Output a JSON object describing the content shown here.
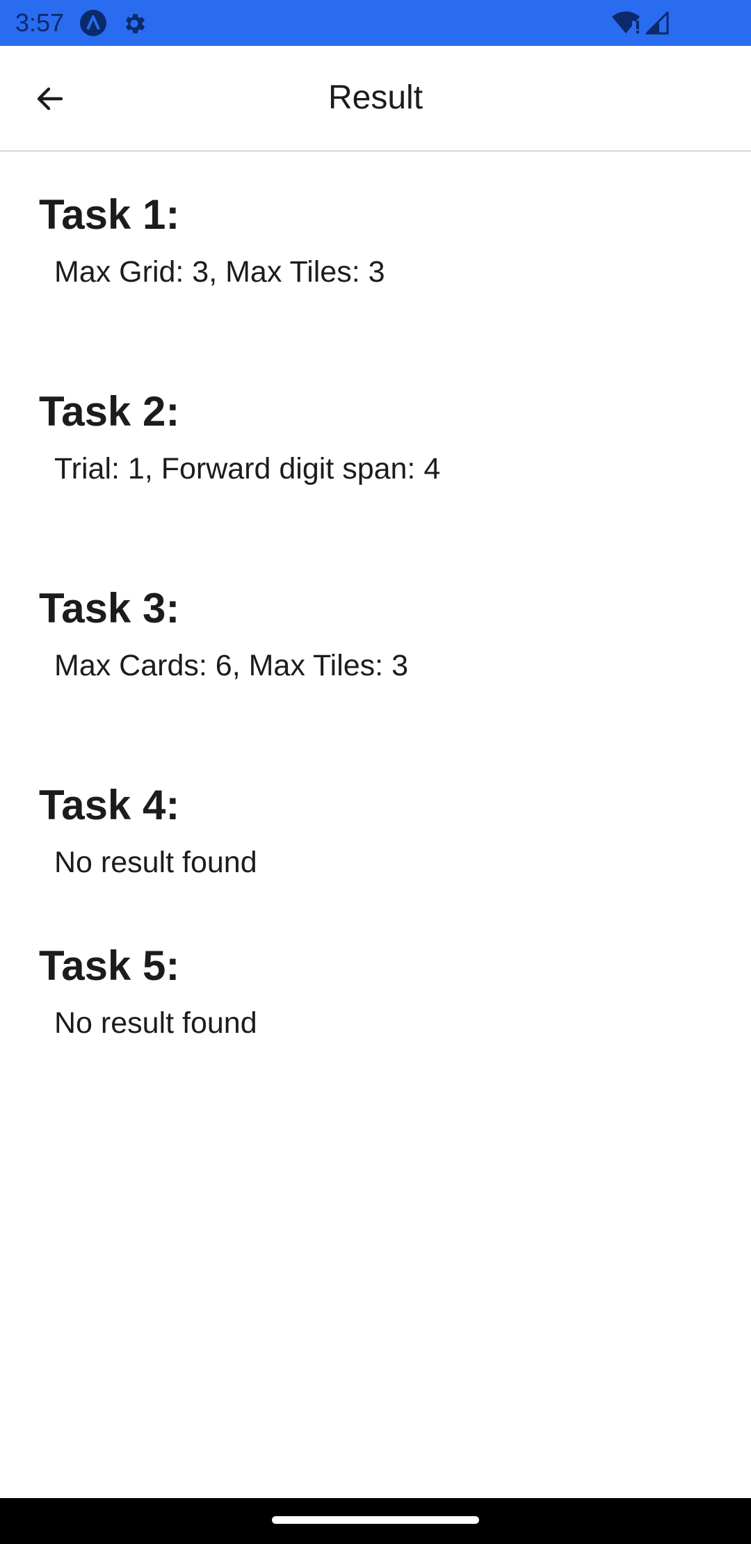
{
  "status_bar": {
    "time": "3:57",
    "background_color": "#2a6cf0",
    "icons": [
      "a-letter-icon",
      "gear-icon",
      "wifi-alert-icon",
      "cell-signal-icon"
    ]
  },
  "app_bar": {
    "back_icon": "arrow-left-icon",
    "title": "Result"
  },
  "tasks": [
    {
      "title": "Task 1:",
      "result": "Max Grid: 3, Max Tiles: 3"
    },
    {
      "title": "Task 2:",
      "result": "Trial: 1, Forward digit span: 4"
    },
    {
      "title": "Task 3:",
      "result": "Max Cards: 6, Max Tiles: 3"
    },
    {
      "title": "Task 4:",
      "result": "No result found"
    },
    {
      "title": "Task 5:",
      "result": "No result found"
    }
  ]
}
